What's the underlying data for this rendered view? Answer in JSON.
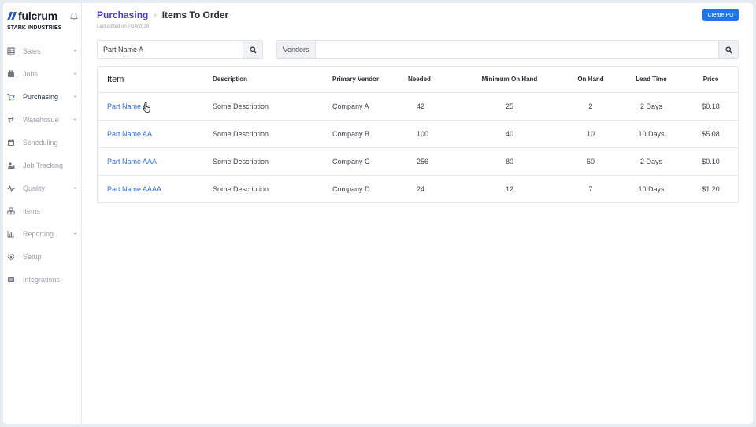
{
  "sidebar": {
    "logo_text": "fulcrum",
    "company": "STARK INDUSTRIES",
    "items": [
      {
        "label": "Sales",
        "icon": "grid-icon",
        "chevron": true
      },
      {
        "label": "Jobs",
        "icon": "briefcase-icon",
        "chevron": true
      },
      {
        "label": "Purchasing",
        "icon": "cart-icon",
        "chevron": true,
        "active": true
      },
      {
        "label": "Warehosue",
        "icon": "transfer-icon",
        "chevron": true
      },
      {
        "label": "Scheduling",
        "icon": "calendar-icon",
        "chevron": false
      },
      {
        "label": "Job Tracking",
        "icon": "people-icon",
        "chevron": false
      },
      {
        "label": "Quality",
        "icon": "pulse-icon",
        "chevron": true
      },
      {
        "label": "Items",
        "icon": "boxes-icon",
        "chevron": false
      },
      {
        "label": "Reporting",
        "icon": "bar-chart-icon",
        "chevron": true
      },
      {
        "label": "Setup",
        "icon": "gear-icon",
        "chevron": false
      },
      {
        "label": "Integrations",
        "icon": "plug-icon",
        "chevron": false
      }
    ]
  },
  "header": {
    "breadcrumb_parent": "Purchasing",
    "breadcrumb_current": "Items To Order",
    "last_edited": "Last edited on 7/14/2019",
    "create_po_label": "Create PO"
  },
  "search": {
    "part_value": "Part Name A",
    "vendors_label": "Vendors",
    "vendors_value": ""
  },
  "table": {
    "headers": {
      "item": "Item",
      "description": "Description",
      "vendor": "Primary Vendor",
      "needed": "Needed",
      "min_on_hand": "Minimum On Hand",
      "on_hand": "On Hand",
      "lead_time": "Lead Time",
      "price": "Price"
    },
    "rows": [
      {
        "item": "Part Name A",
        "description": "Some Description",
        "vendor": "Company A",
        "needed": "42",
        "min_on_hand": "25",
        "on_hand": "2",
        "lead_time": "2 Days",
        "price": "$0.18"
      },
      {
        "item": "Part Name AA",
        "description": "Some Description",
        "vendor": "Company B",
        "needed": "100",
        "min_on_hand": "40",
        "on_hand": "10",
        "lead_time": "10 Days",
        "price": "$5.08"
      },
      {
        "item": "Part Name AAA",
        "description": "Some Description",
        "vendor": "Company C",
        "needed": "256",
        "min_on_hand": "80",
        "on_hand": "60",
        "lead_time": "2 Days",
        "price": "$0.10"
      },
      {
        "item": "Part Name AAAA",
        "description": "Some Description",
        "vendor": "Company D",
        "needed": "24",
        "min_on_hand": "12",
        "on_hand": "7",
        "lead_time": "10 Days",
        "price": "$1.20"
      }
    ]
  },
  "colors": {
    "accent": "#1f74e6",
    "breadcrumb": "#4c3fc3",
    "link": "#2e6fd6",
    "active_nav": "#1d2a52",
    "muted_nav": "#9aa0aa"
  }
}
